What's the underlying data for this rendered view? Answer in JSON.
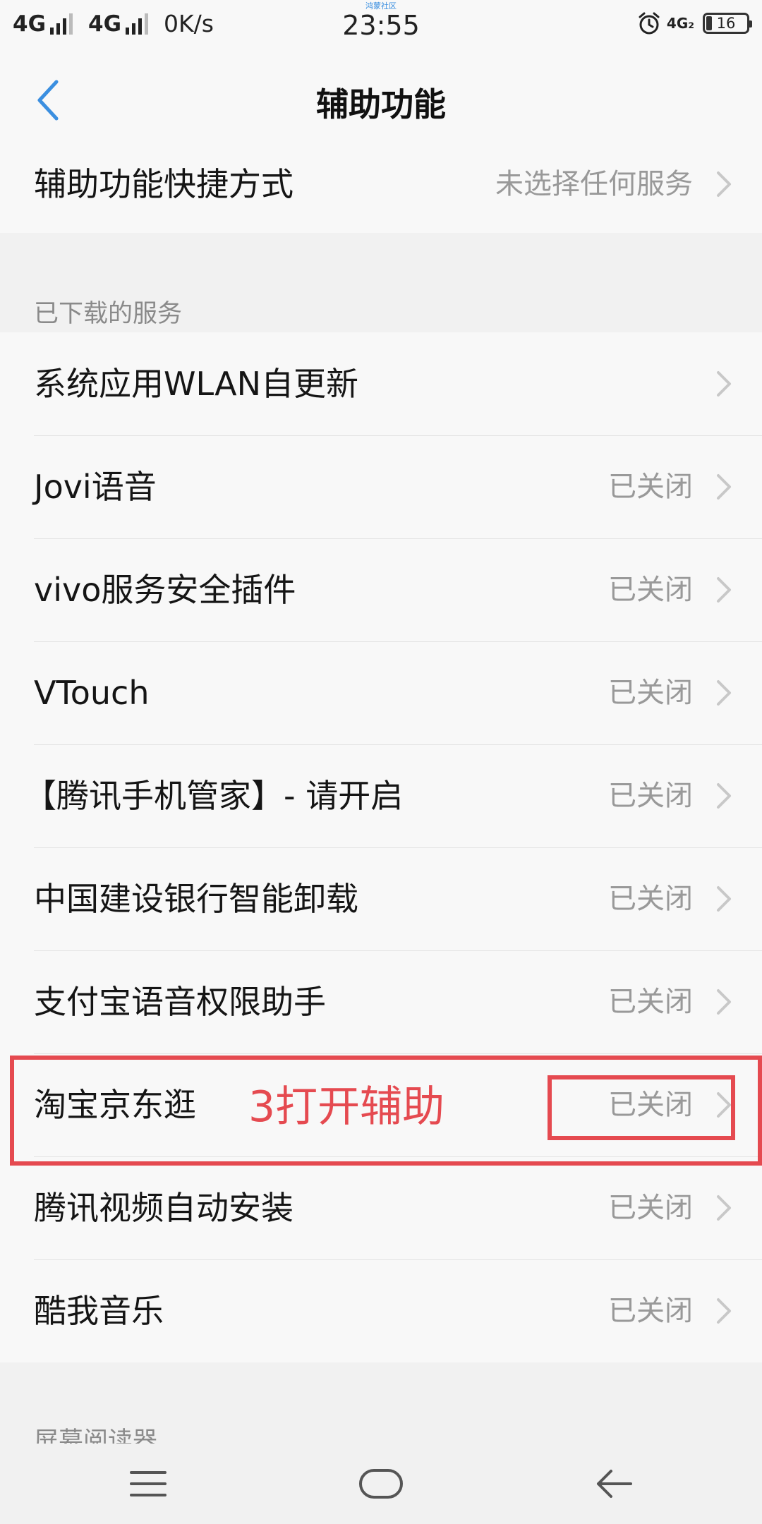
{
  "status_bar": {
    "net1": "4G",
    "net2": "4G",
    "speed": "0K/s",
    "watermark": "鸿蒙社区",
    "time": "23:55",
    "net3": "4G₂",
    "battery": "16"
  },
  "header": {
    "title": "辅助功能"
  },
  "shortcut": {
    "label": "辅助功能快捷方式",
    "value": "未选择任何服务"
  },
  "downloaded": {
    "header": "已下载的服务",
    "items": [
      {
        "label": "系统应用WLAN自更新",
        "status": ""
      },
      {
        "label": "Jovi语音",
        "status": "已关闭"
      },
      {
        "label": "vivo服务安全插件",
        "status": "已关闭"
      },
      {
        "label": "VTouch",
        "status": "已关闭"
      },
      {
        "label": "【腾讯手机管家】- 请开启",
        "status": "已关闭"
      },
      {
        "label": "中国建设银行智能卸载",
        "status": "已关闭"
      },
      {
        "label": "支付宝语音权限助手",
        "status": "已关闭"
      },
      {
        "label": "淘宝京东逛",
        "status": "已关闭"
      },
      {
        "label": "腾讯视频自动安装",
        "status": "已关闭"
      },
      {
        "label": "酷我音乐",
        "status": "已关闭"
      }
    ]
  },
  "next_section": {
    "header": "屏幕阅读器"
  },
  "annotation": {
    "text": "3打开辅助",
    "color": "#e54a50"
  },
  "colors": {
    "accent": "#3b8fe0",
    "annotation": "#e54a50"
  },
  "icons": {
    "back": "chevron-left-icon",
    "row_arrow": "chevron-right-icon",
    "nav_menu": "menu-icon",
    "nav_home": "home-icon",
    "nav_back": "back-arrow-icon"
  }
}
